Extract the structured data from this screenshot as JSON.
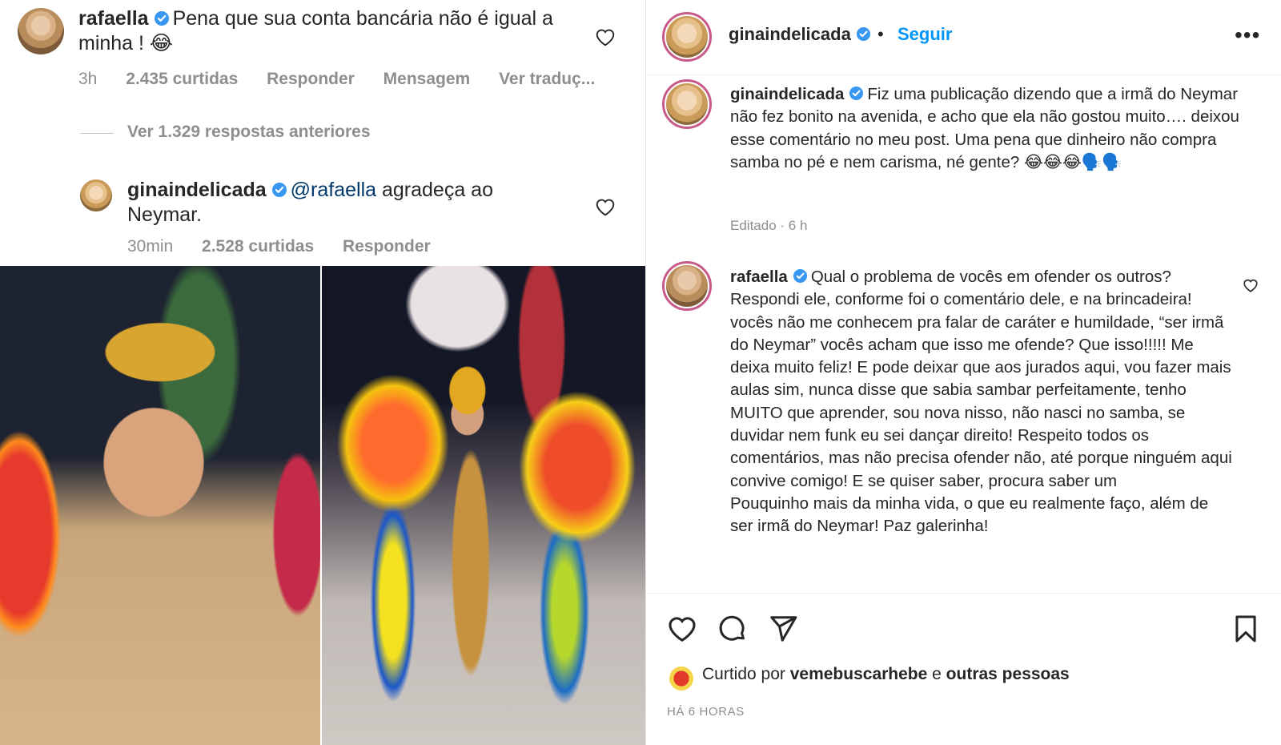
{
  "left": {
    "comment1": {
      "username": "rafaella",
      "text": "Pena que sua conta bancária não é igual a minha ! 😂",
      "time": "3h",
      "likes": "2.435 curtidas",
      "reply": "Responder",
      "message": "Mensagem",
      "translate": "Ver traduç..."
    },
    "view_replies": "Ver 1.329 respostas anteriores",
    "comment2": {
      "username": "ginaindelicada",
      "mention": "@rafaella",
      "text": " agradeça ao Neymar.",
      "time": "30min",
      "likes": "2.528 curtidas",
      "reply": "Responder"
    }
  },
  "right": {
    "header": {
      "username": "ginaindelicada",
      "dot": "•",
      "follow": "Seguir",
      "more": "•••"
    },
    "caption": {
      "username": "ginaindelicada",
      "text": "Fiz uma publicação dizendo que a irmã do Neymar não fez bonito na avenida, e acho que ela não gostou muito…. deixou esse comentário no meu post. Uma pena que dinheiro não compra samba no pé e nem carisma, né gente? 😂😂😂🗣️🗣️",
      "meta": "Editado · 6 h"
    },
    "reply": {
      "username": "rafaella",
      "text": "Qual o problema de vocês em ofender os outros? Respondi ele, conforme foi o comentário dele, e na brincadeira! vocês não me conhecem pra falar de caráter e humildade, “ser irmã do Neymar” vocês acham que isso me ofende? Que isso!!!!! Me deixa muito feliz! E pode deixar que aos jurados aqui, vou fazer mais aulas sim, nunca disse que sabia sambar perfeitamente, tenho MUITO que aprender, sou nova nisso, não nasci no samba, se duvidar nem funk eu sei dançar direito! Respeito todos os comentários, mas não precisa ofender não, até porque ninguém aqui convive comigo! E se quiser saber, procura saber um",
      "text2": "Pouquinho mais da minha vida, o que eu realmente faço, além de ser irmã do Neymar! Paz galerinha!"
    },
    "liked_by": {
      "prefix": "Curtido por ",
      "user": "vemebuscarhebe",
      "middle": " e ",
      "others": "outras pessoas"
    },
    "date": "HÁ 6 HORAS"
  },
  "colors": {
    "link": "#0095f6",
    "mention": "#00376b",
    "muted": "#8e8e8e",
    "text": "#262626",
    "verified": "#3897f0"
  }
}
